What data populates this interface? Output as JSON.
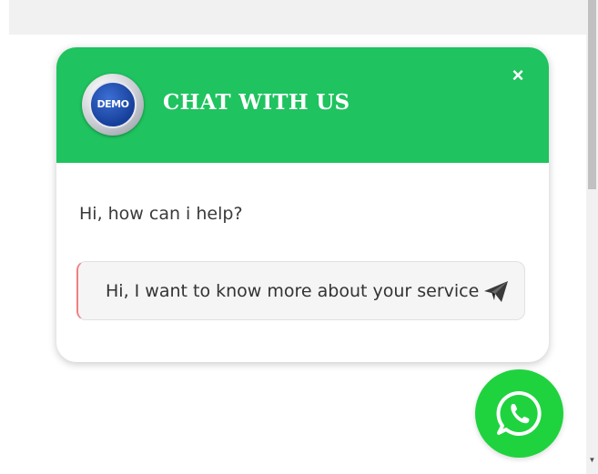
{
  "chat_widget": {
    "avatar_text": "DEMO",
    "title": "CHAT WITH US",
    "close_label": "×",
    "greeting": "Hi, how can i help?",
    "message_value": "Hi, I want to know more about your service",
    "header_color": "#1fc35f"
  },
  "launcher": {
    "icon": "whatsapp-icon",
    "color": "#1fd33e"
  },
  "scrollbar": {
    "down_arrow": "▼"
  },
  "icons": {
    "send": "send-icon",
    "close": "close-icon"
  }
}
